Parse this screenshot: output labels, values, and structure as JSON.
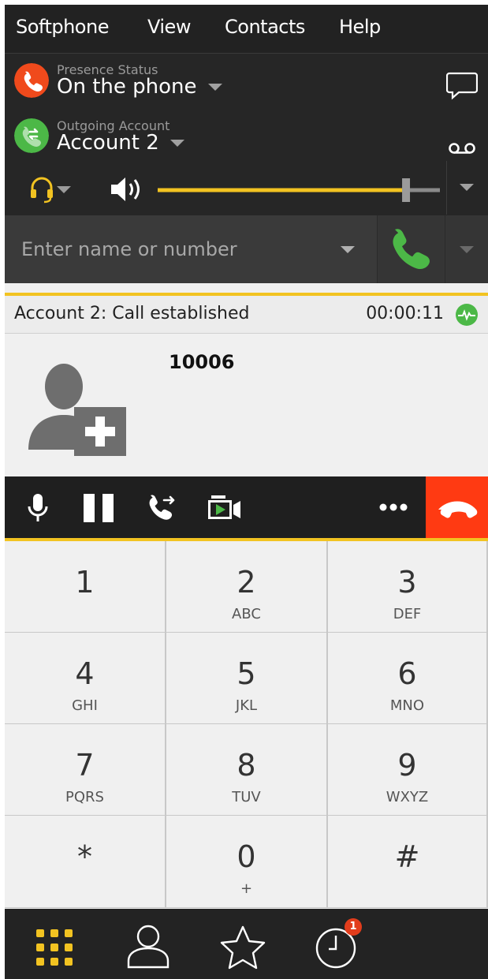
{
  "menu": {
    "items": [
      "Softphone",
      "View",
      "Contacts",
      "Help"
    ]
  },
  "presence": {
    "label": "Presence Status",
    "value": "On the phone",
    "icon": "phone-icon",
    "color": "#f04a1c"
  },
  "account": {
    "label": "Outgoing Account",
    "value": "Account 2",
    "icon": "account-swap-icon",
    "color": "#4cb847"
  },
  "audio": {
    "volume_fraction": 0.88,
    "accent_color": "#f2c321"
  },
  "dial": {
    "placeholder": "Enter name or number"
  },
  "call": {
    "status": "Account 2: Call established",
    "timer": "00:00:11",
    "number": "10006"
  },
  "keypad": {
    "keys": [
      {
        "digit": "1",
        "letters": ""
      },
      {
        "digit": "2",
        "letters": "ABC"
      },
      {
        "digit": "3",
        "letters": "DEF"
      },
      {
        "digit": "4",
        "letters": "GHI"
      },
      {
        "digit": "5",
        "letters": "JKL"
      },
      {
        "digit": "6",
        "letters": "MNO"
      },
      {
        "digit": "7",
        "letters": "PQRS"
      },
      {
        "digit": "8",
        "letters": "TUV"
      },
      {
        "digit": "9",
        "letters": "WXYZ"
      },
      {
        "digit": "*",
        "letters": ""
      },
      {
        "digit": "0",
        "letters": "+"
      },
      {
        "digit": "#",
        "letters": ""
      }
    ]
  },
  "nav": {
    "history_badge": "1"
  },
  "colors": {
    "accent": "#f2c321",
    "hangup": "#ff3a12",
    "call_green": "#4cb847"
  }
}
